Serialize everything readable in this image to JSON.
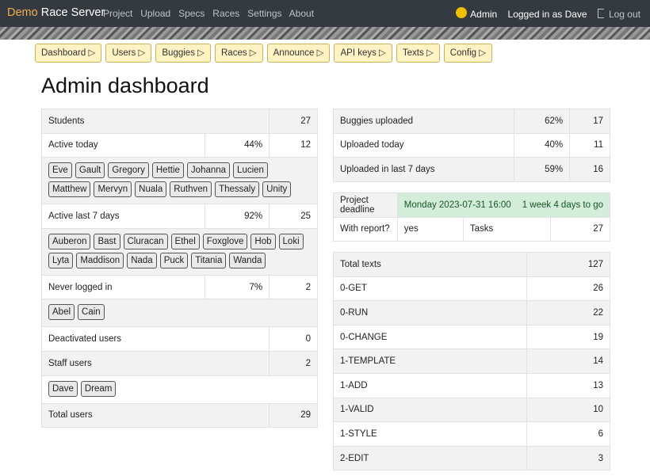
{
  "nav": {
    "brand_demo": "Demo",
    "brand_name": "Race Server",
    "links": [
      "Project",
      "Upload",
      "Specs",
      "Races",
      "Settings",
      "About"
    ],
    "admin_label": "Admin",
    "logged_in": "Logged in as Dave",
    "logout_label": "Log out"
  },
  "subnav": [
    "Dashboard ▷",
    "Users ▷",
    "Buggies ▷",
    "Races ▷",
    "Announce ▷",
    "API keys ▷",
    "Texts ▷",
    "Config ▷"
  ],
  "page_title": "Admin dashboard",
  "users": {
    "students_label": "Students",
    "students_count": "27",
    "active_today_label": "Active today",
    "active_today_pct": "44%",
    "active_today_count": "12",
    "active_today_users": [
      "Eve",
      "Gault",
      "Gregory",
      "Hettie",
      "Johanna",
      "Lucien",
      "Matthew",
      "Mervyn",
      "Nuala",
      "Ruthven",
      "Thessaly",
      "Unity"
    ],
    "active_7_label": "Active last 7 days",
    "active_7_pct": "92%",
    "active_7_count": "25",
    "active_7_users": [
      "Auberon",
      "Bast",
      "Cluracan",
      "Ethel",
      "Foxglove",
      "Hob",
      "Loki",
      "Lyta",
      "Maddison",
      "Nada",
      "Puck",
      "Titania",
      "Wanda"
    ],
    "never_label": "Never logged in",
    "never_pct": "7%",
    "never_count": "2",
    "never_users": [
      "Abel",
      "Cain"
    ],
    "deactivated_label": "Deactivated users",
    "deactivated_count": "0",
    "staff_label": "Staff users",
    "staff_count": "2",
    "staff_users": [
      "Dave",
      "Dream"
    ],
    "total_label": "Total users",
    "total_count": "29"
  },
  "buggies": {
    "uploaded_label": "Buggies uploaded",
    "uploaded_pct": "62%",
    "uploaded_count": "17",
    "today_label": "Uploaded today",
    "today_pct": "40%",
    "today_count": "11",
    "last7_label": "Uploaded in last 7 days",
    "last7_pct": "59%",
    "last7_count": "16"
  },
  "project": {
    "deadline_label": "Project deadline",
    "deadline_value": "Monday 2023-07-31 16:00",
    "deadline_remaining": "1 week 4 days to go",
    "report_label": "With report?",
    "report_value": "yes",
    "tasks_label": "Tasks",
    "tasks_count": "27"
  },
  "texts": {
    "total_label": "Total texts",
    "total_count": "127",
    "rows": [
      {
        "label": "0-GET",
        "count": "26"
      },
      {
        "label": "0-RUN",
        "count": "22"
      },
      {
        "label": "0-CHANGE",
        "count": "19"
      },
      {
        "label": "1-TEMPLATE",
        "count": "14"
      },
      {
        "label": "1-ADD",
        "count": "13"
      },
      {
        "label": "1-VALID",
        "count": "10"
      },
      {
        "label": "1-STYLE",
        "count": "6"
      },
      {
        "label": "2-EDIT",
        "count": "3"
      }
    ]
  }
}
